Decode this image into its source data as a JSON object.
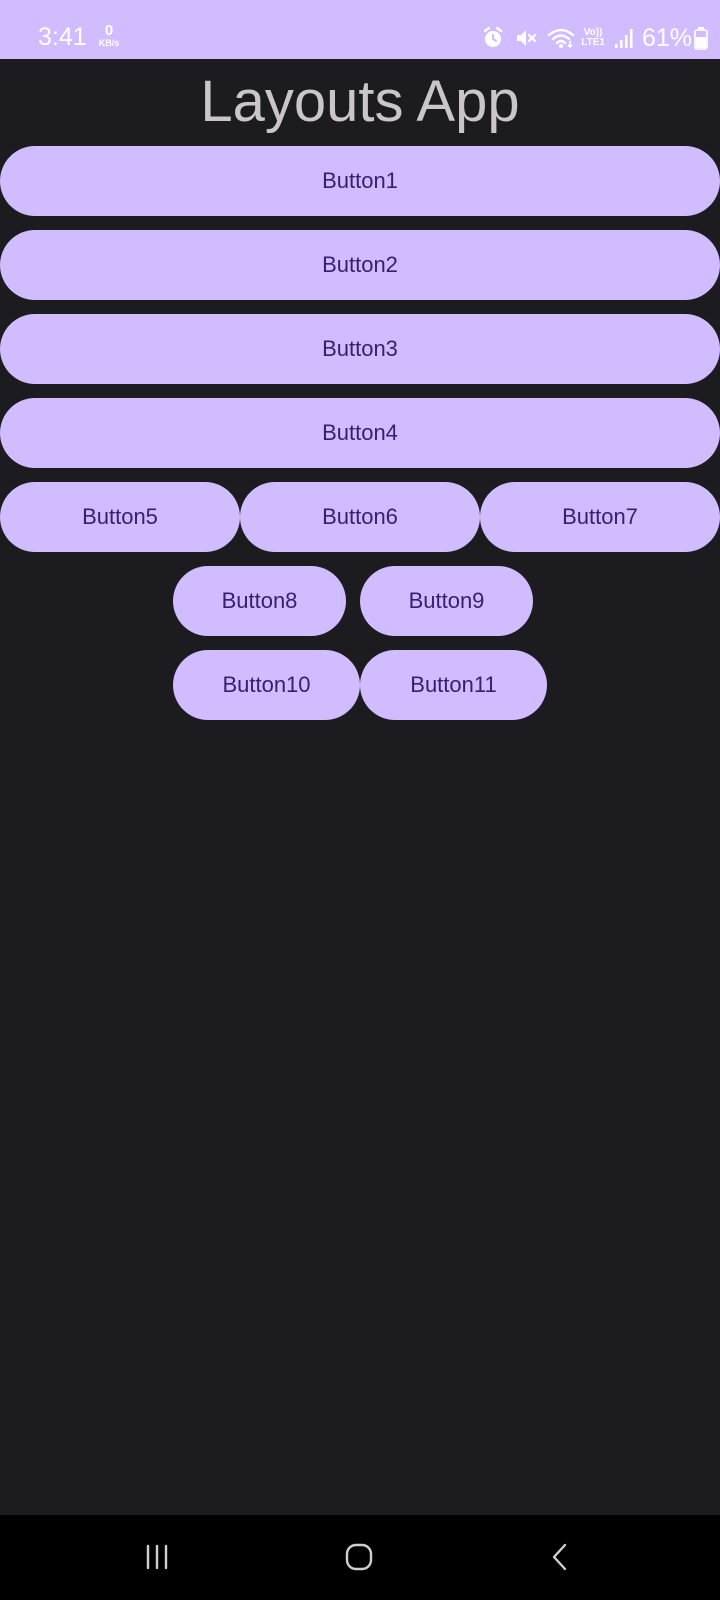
{
  "status_bar": {
    "time": "3:41",
    "net_speed_value": "0",
    "net_speed_unit": "KB/s",
    "volte_label": "Vo))",
    "lte_label": "LTE1",
    "battery_percent": "61%",
    "icons": [
      "alarm-icon",
      "mute-icon",
      "wifi-icon",
      "signal-icon",
      "battery-icon"
    ]
  },
  "app": {
    "title": "Layouts App"
  },
  "buttons": {
    "b1": "Button1",
    "b2": "Button2",
    "b3": "Button3",
    "b4": "Button4",
    "b5": "Button5",
    "b6": "Button6",
    "b7": "Button7",
    "b8": "Button8",
    "b9": "Button9",
    "b10": "Button10",
    "b11": "Button11"
  },
  "nav": {
    "icons": [
      "recents-icon",
      "home-icon",
      "back-icon"
    ]
  },
  "colors": {
    "accent": "#d0bcff",
    "on_accent": "#381e72",
    "background": "#1c1b1f",
    "title_text": "#c9c5ca"
  }
}
